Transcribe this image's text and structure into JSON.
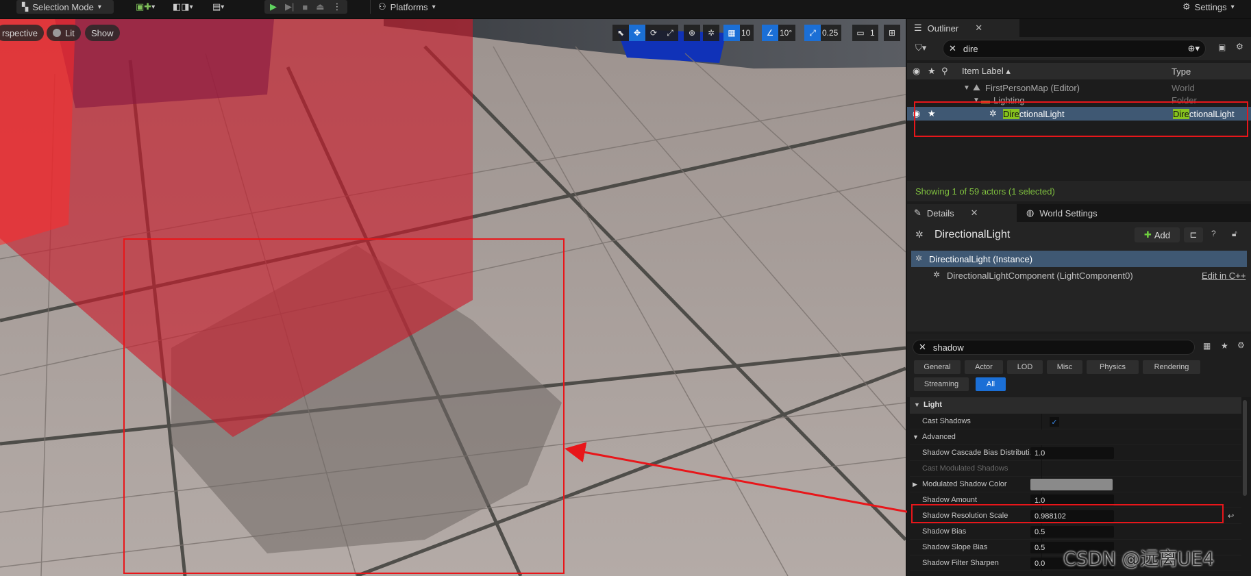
{
  "toolbar": {
    "mode_label": "Selection Mode",
    "platforms_label": "Platforms",
    "settings_label": "Settings"
  },
  "viewport": {
    "view_label": "rspective",
    "lit_label": "Lit",
    "show_label": "Show",
    "grid_snap_value": "10",
    "rotation_snap_value": "10°",
    "scale_snap_value": "0.25",
    "camera_speed_value": "1"
  },
  "outliner": {
    "tab_label": "Outliner",
    "search_value": "dire",
    "col_label": "Item Label ▴",
    "col_type": "Type",
    "rows": [
      {
        "label": "FirstPersonMap (Editor)",
        "type": "World"
      },
      {
        "label": "Lighting",
        "type": "Folder"
      },
      {
        "label_hl": "Dire",
        "label_rest": "ctionalLight",
        "type_hl": "Dire",
        "type_rest": "ctionalLight"
      }
    ],
    "status": "Showing 1 of 59 actors (1 selected)"
  },
  "details": {
    "tab_label": "Details",
    "world_settings_label": "World Settings",
    "actor_name": "DirectionalLight",
    "add_label": "Add",
    "instance_label": "DirectionalLight (Instance)",
    "component_label": "DirectionalLightComponent (LightComponent0)",
    "edit_cpp_label": "Edit in C++",
    "search_value": "shadow",
    "filters": [
      "General",
      "Actor",
      "LOD",
      "Misc",
      "Physics",
      "Rendering",
      "Streaming",
      "All"
    ],
    "active_filter": "All",
    "section_label": "Light",
    "advanced_label": "Advanced",
    "props": [
      {
        "name": "Cast Shadows",
        "value": ""
      },
      {
        "name": "Shadow Cascade Bias Distributi...",
        "value": "1.0"
      },
      {
        "name": "Cast Modulated Shadows",
        "value": ""
      },
      {
        "name": "Modulated Shadow Color",
        "value": ""
      },
      {
        "name": "Shadow Amount",
        "value": "1.0"
      },
      {
        "name": "Shadow Resolution Scale",
        "value": "0.988102"
      },
      {
        "name": "Shadow Bias",
        "value": "0.5"
      },
      {
        "name": "Shadow Slope Bias",
        "value": "0.5"
      },
      {
        "name": "Shadow Filter Sharpen",
        "value": "0.0"
      }
    ]
  },
  "watermark": "CSDN @远离UE4",
  "colors": {
    "accent_blue": "#1b6fd6",
    "selection_row": "#3f5873",
    "highlight_green": "#86c31f",
    "annotation_red": "#e8161a",
    "status_green": "#7fbf3f"
  }
}
